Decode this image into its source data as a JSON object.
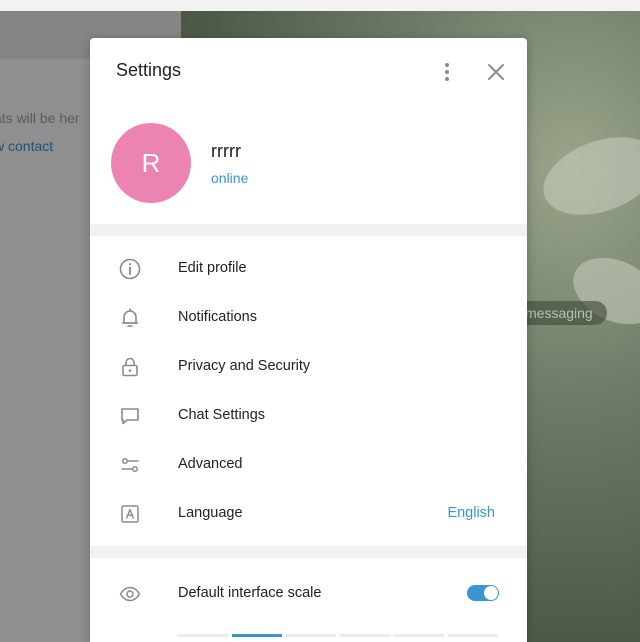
{
  "background": {
    "left_hint_text": "ats will be her",
    "left_link_text": "w contact",
    "messaging_pill": "messaging"
  },
  "settings": {
    "title": "Settings",
    "more_icon": "vertical-dots-icon",
    "close_icon": "close-icon",
    "profile": {
      "avatar_letter": "R",
      "avatar_color": "#eb84b0",
      "name": "rrrrr",
      "status": "online"
    },
    "menu": [
      {
        "icon": "info-icon",
        "label": "Edit profile"
      },
      {
        "icon": "bell-icon",
        "label": "Notifications"
      },
      {
        "icon": "lock-icon",
        "label": "Privacy and Security"
      },
      {
        "icon": "chat-bubble-icon",
        "label": "Chat Settings"
      },
      {
        "icon": "sliders-icon",
        "label": "Advanced"
      },
      {
        "icon": "language-icon",
        "label": "Language",
        "value": "English"
      }
    ],
    "scale": {
      "icon": "eye-icon",
      "label": "Default interface scale",
      "toggle_on": true
    }
  },
  "colors": {
    "accent": "#3a95d3"
  }
}
